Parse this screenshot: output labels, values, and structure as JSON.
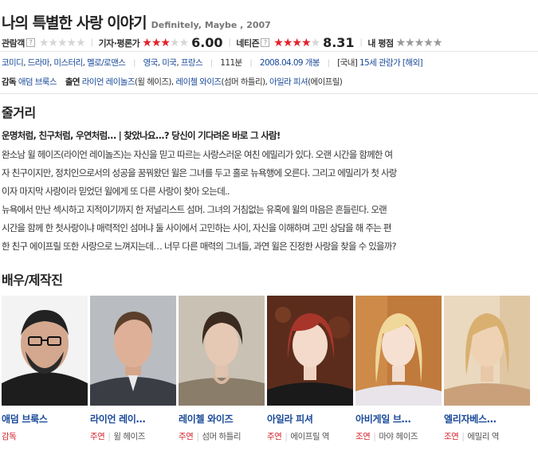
{
  "title": {
    "main": "나의 특별한 사랑 이야기",
    "original": "Definitely, Maybe , 2007"
  },
  "ratings": [
    {
      "label": "관람객",
      "help": "?",
      "stars": 0,
      "score": "",
      "style": "red"
    },
    {
      "label": "기자·평론가",
      "help": "",
      "stars": 3,
      "score": "6.00",
      "style": "red"
    },
    {
      "label": "네티즌",
      "help": "?",
      "stars": 4,
      "score": "8.31",
      "style": "red"
    },
    {
      "label": "내 평점",
      "help": "",
      "stars": 5,
      "score": "",
      "style": "gray"
    }
  ],
  "star_glyphs": "★★★★★",
  "meta": {
    "genres": [
      "코미디",
      "드라마",
      "미스터리",
      "멜로/로맨스"
    ],
    "countries": [
      "영국",
      "미국",
      "프랑스"
    ],
    "runtime": "111분",
    "release": "2008.04.09 개봉",
    "region": "[국내]",
    "age_rating": "15세 관람가",
    "overseas": "[해외]"
  },
  "credits": {
    "director_label": "감독",
    "director": "애덤 브룩스",
    "cast_label": "출연",
    "cast": [
      {
        "name": "라이언 레이놀즈",
        "role": "(윌 헤이즈)"
      },
      {
        "name": "레이첼 와이즈",
        "role": "(섬머 하틀리)"
      },
      {
        "name": "아일라 피셔",
        "role": "(에이프릴)"
      }
    ]
  },
  "synopsis": {
    "heading": "줄거리",
    "tagline": "운명처럼, 친구처럼, 우연처럼… | 찾았나요...? 당신이 기다려온 바로 그 사람!",
    "lines": [
      "완소남 윌 헤이즈(라이언 레이놀즈)는 자신을 믿고 따르는 사랑스러운 여친 에밀리가 있다. 오랜 시간을 함께한 여",
      "자 친구이지만, 정치인으로서의 성공을 꿈꿔왔던 윌은 그녀를 두고 홀로 뉴욕행에 오른다. 그리고 에밀리가 첫 사랑",
      "이자 마지막 사랑이라 믿었던 윌에게 또 다른 사랑이 찾아 오는데..",
      " 뉴욕에서 만난 섹시하고 지적이기까지 한 저널리스트 섬머. 그녀의 거침없는 유혹에 윌의 마음은 흔들린다. 오랜",
      "시간을 함께 한 첫사랑이냐 매력적인 섬머냐 둘 사이에서 고민하는 사이, 자신을 이해하며 고민 상담을 해 주는 편",
      "한 친구 에이프릴 또한 사랑으로 느껴지는데… 너무 다른 매력의 그녀들, 과연 윌은 진정한 사랑을 찾을 수 있을까?"
    ]
  },
  "cast_section": {
    "heading": "배우/제작진",
    "people": [
      {
        "name": "애덤 브룩스",
        "kind": "감독",
        "role": ""
      },
      {
        "name": "라이언 레이…",
        "kind": "주연",
        "role": "윌 헤이즈"
      },
      {
        "name": "레이첼 와이즈",
        "kind": "주연",
        "role": "섬머 하틀리"
      },
      {
        "name": "아일라 피셔",
        "kind": "주연",
        "role": "에이프릴 역"
      },
      {
        "name": "아비게일 브…",
        "kind": "조연",
        "role": "마야 헤이즈"
      },
      {
        "name": "엘리자베스…",
        "kind": "조연",
        "role": "에밀리 역"
      }
    ]
  },
  "colors": {
    "star_red": "#e4202a",
    "star_gray": "#9a9a9a",
    "link": "#1a4a9a",
    "role_red": "#d6242b"
  }
}
